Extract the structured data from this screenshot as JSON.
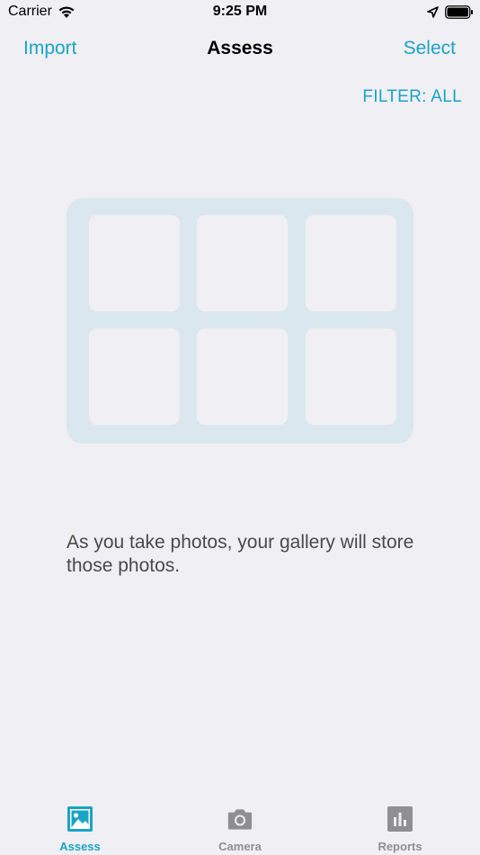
{
  "status": {
    "carrier": "Carrier",
    "time": "9:25 PM"
  },
  "nav": {
    "left": "Import",
    "title": "Assess",
    "right": "Select"
  },
  "filter": "FILTER: ALL",
  "empty_message": "As you take photos, your gallery will store those photos.",
  "tabs": [
    {
      "label": "Assess",
      "icon": "image-icon"
    },
    {
      "label": "Camera",
      "icon": "camera-icon"
    },
    {
      "label": "Reports",
      "icon": "bar-chart-icon"
    }
  ],
  "colors": {
    "accent": "#1aa3c7",
    "background": "#f0eff4",
    "placeholder": "#dbe7ef",
    "inactive": "#8e8e93"
  }
}
